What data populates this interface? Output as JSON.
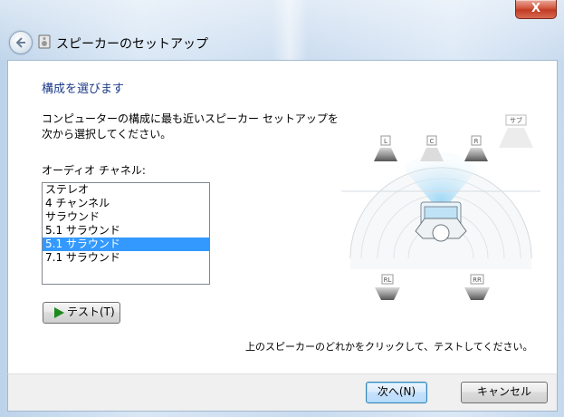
{
  "window": {
    "title": "スピーカーのセットアップ",
    "close_label": "X"
  },
  "content": {
    "heading": "構成を選びます",
    "description": "コンピューターの構成に最も近いスピーカー セットアップを次から選択してください。",
    "channel_label": "オーディオ チャネル:",
    "channel_options": [
      "ステレオ",
      "4 チャンネル",
      "サラウンド",
      "5.1 サラウンド",
      "5.1 サラウンド",
      "7.1 サラウンド"
    ],
    "selected_index": 4,
    "test_button_label": "テスト(T)",
    "instruction": "上のスピーカーのどれかをクリックして、テストしてください。"
  },
  "speakers": {
    "left": "L",
    "center": "C",
    "right": "R",
    "subwoofer": "サブ",
    "rear_left": "RL",
    "rear_right": "RR"
  },
  "footer": {
    "next_label": "次へ(N)",
    "cancel_label": "キャンセル"
  }
}
